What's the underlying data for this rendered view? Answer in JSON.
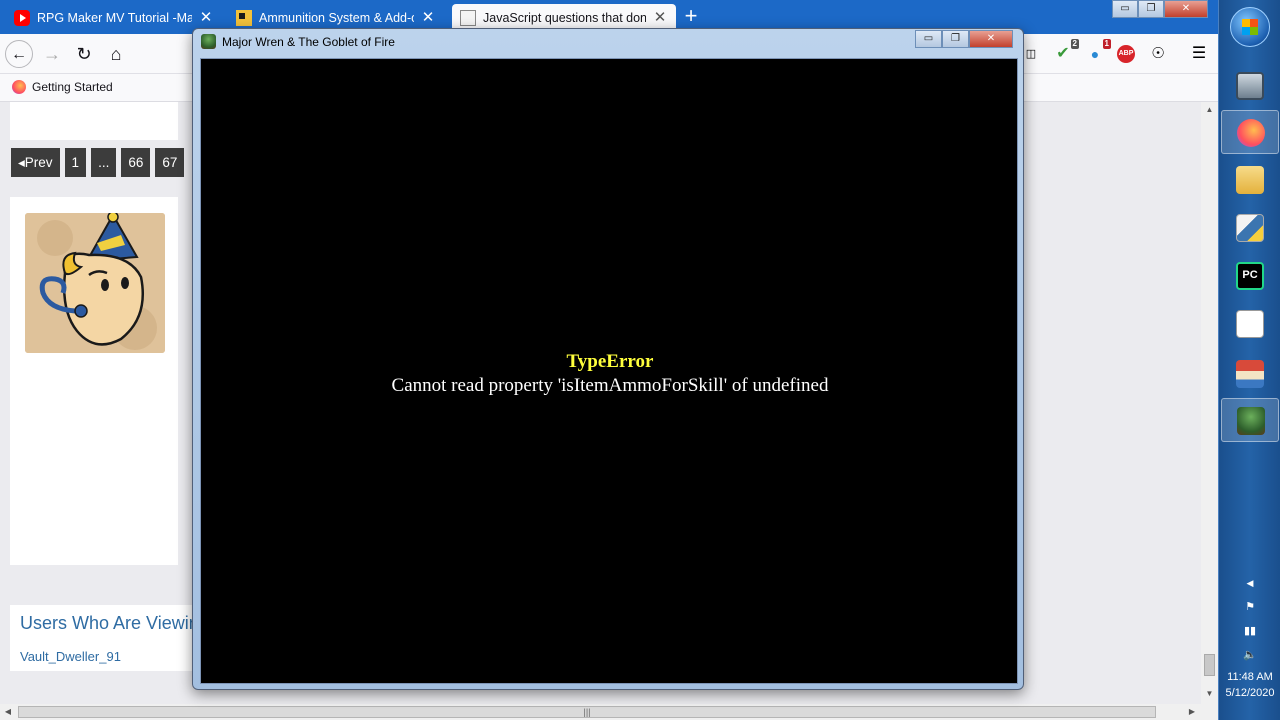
{
  "browser": {
    "tabs": [
      {
        "title": "RPG Maker MV Tutorial -Makin",
        "icon": "youtube-icon"
      },
      {
        "title": "Ammunition System & Add-on",
        "icon": "folder-icon"
      },
      {
        "title": "JavaScript questions that don't",
        "icon": "page-icon"
      }
    ],
    "new_tab_label": "+",
    "bookmark": "Getting Started",
    "extension_badges": {
      "shield": "2",
      "bell": "1",
      "abp": "ABP"
    }
  },
  "page": {
    "pagination": [
      "◂Prev",
      "1",
      "...",
      "66",
      "67"
    ],
    "users_title": "Users Who Are Viewin",
    "users_name": "Vault_Dweller_91"
  },
  "game_window": {
    "title": "Major Wren & The Goblet of Fire",
    "error_title": "TypeError",
    "error_message": "Cannot read property 'isItemAmmoForSkill' of undefined"
  },
  "window_controls": {
    "minimize": "▭",
    "restore": "❐",
    "close": "✕"
  },
  "taskbar": {
    "time": "11:48 AM",
    "date": "5/12/2020"
  },
  "colors": {
    "tab_bar": "#1c69c7",
    "error_title": "#ffff3c",
    "link": "#2f6ca3",
    "taskbar": "#2463a8"
  }
}
